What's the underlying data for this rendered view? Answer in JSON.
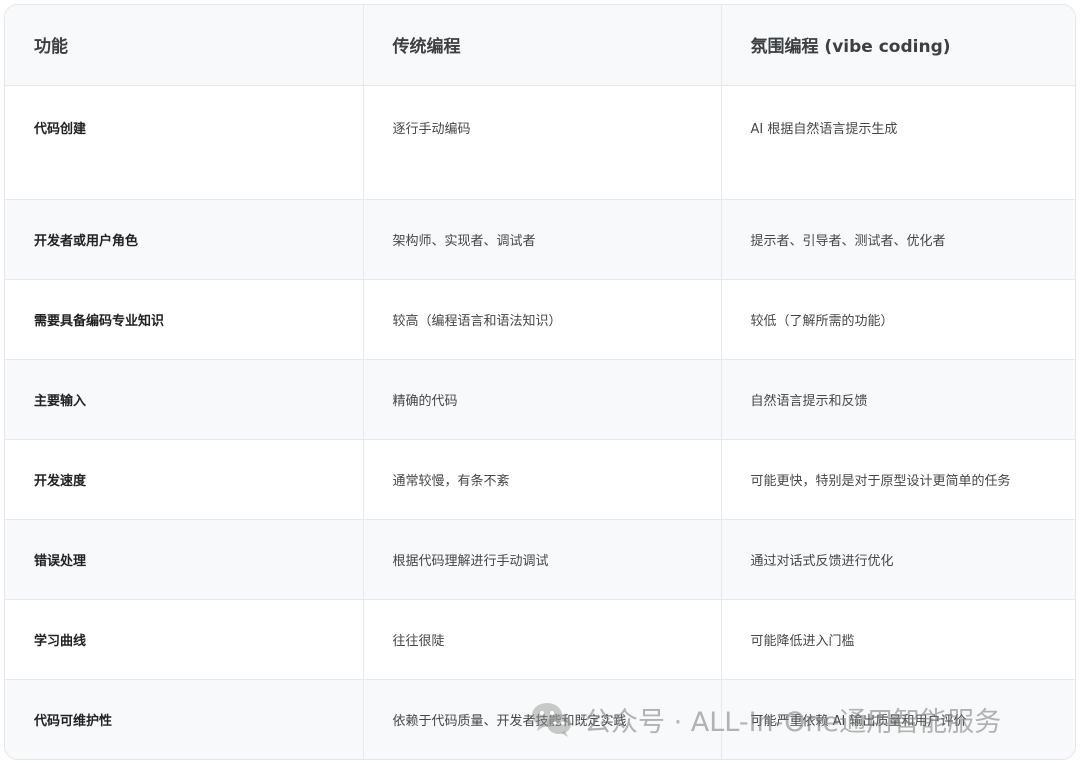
{
  "table": {
    "headers": [
      "功能",
      "传统编程",
      "氛围编程 (vibe coding)"
    ],
    "rows": [
      [
        "代码创建",
        "逐行手动编码",
        "AI 根据自然语言提示生成"
      ],
      [
        "开发者或用户角色",
        "架构师、实现者、调试者",
        "提示者、引导者、测试者、优化者"
      ],
      [
        "需要具备编码专业知识",
        "较高（编程语言和语法知识）",
        "较低（了解所需的功能）"
      ],
      [
        "主要输入",
        "精确的代码",
        "自然语言提示和反馈"
      ],
      [
        "开发速度",
        "通常较慢，有条不紊",
        "可能更快，特别是对于原型设计更简单的任务"
      ],
      [
        "错误处理",
        "根据代码理解进行手动调试",
        "通过对话式反馈进行优化"
      ],
      [
        "学习曲线",
        "往往很陡",
        "可能降低进入门槛"
      ],
      [
        "代码可维护性",
        "依赖于代码质量、开发者技能和既定实践",
        "可能严重依赖 AI 输出质量和用户评价"
      ]
    ]
  },
  "watermark": {
    "text": "公众号 · ALL-In-One通用智能服务",
    "icon": "wechat-icon"
  }
}
